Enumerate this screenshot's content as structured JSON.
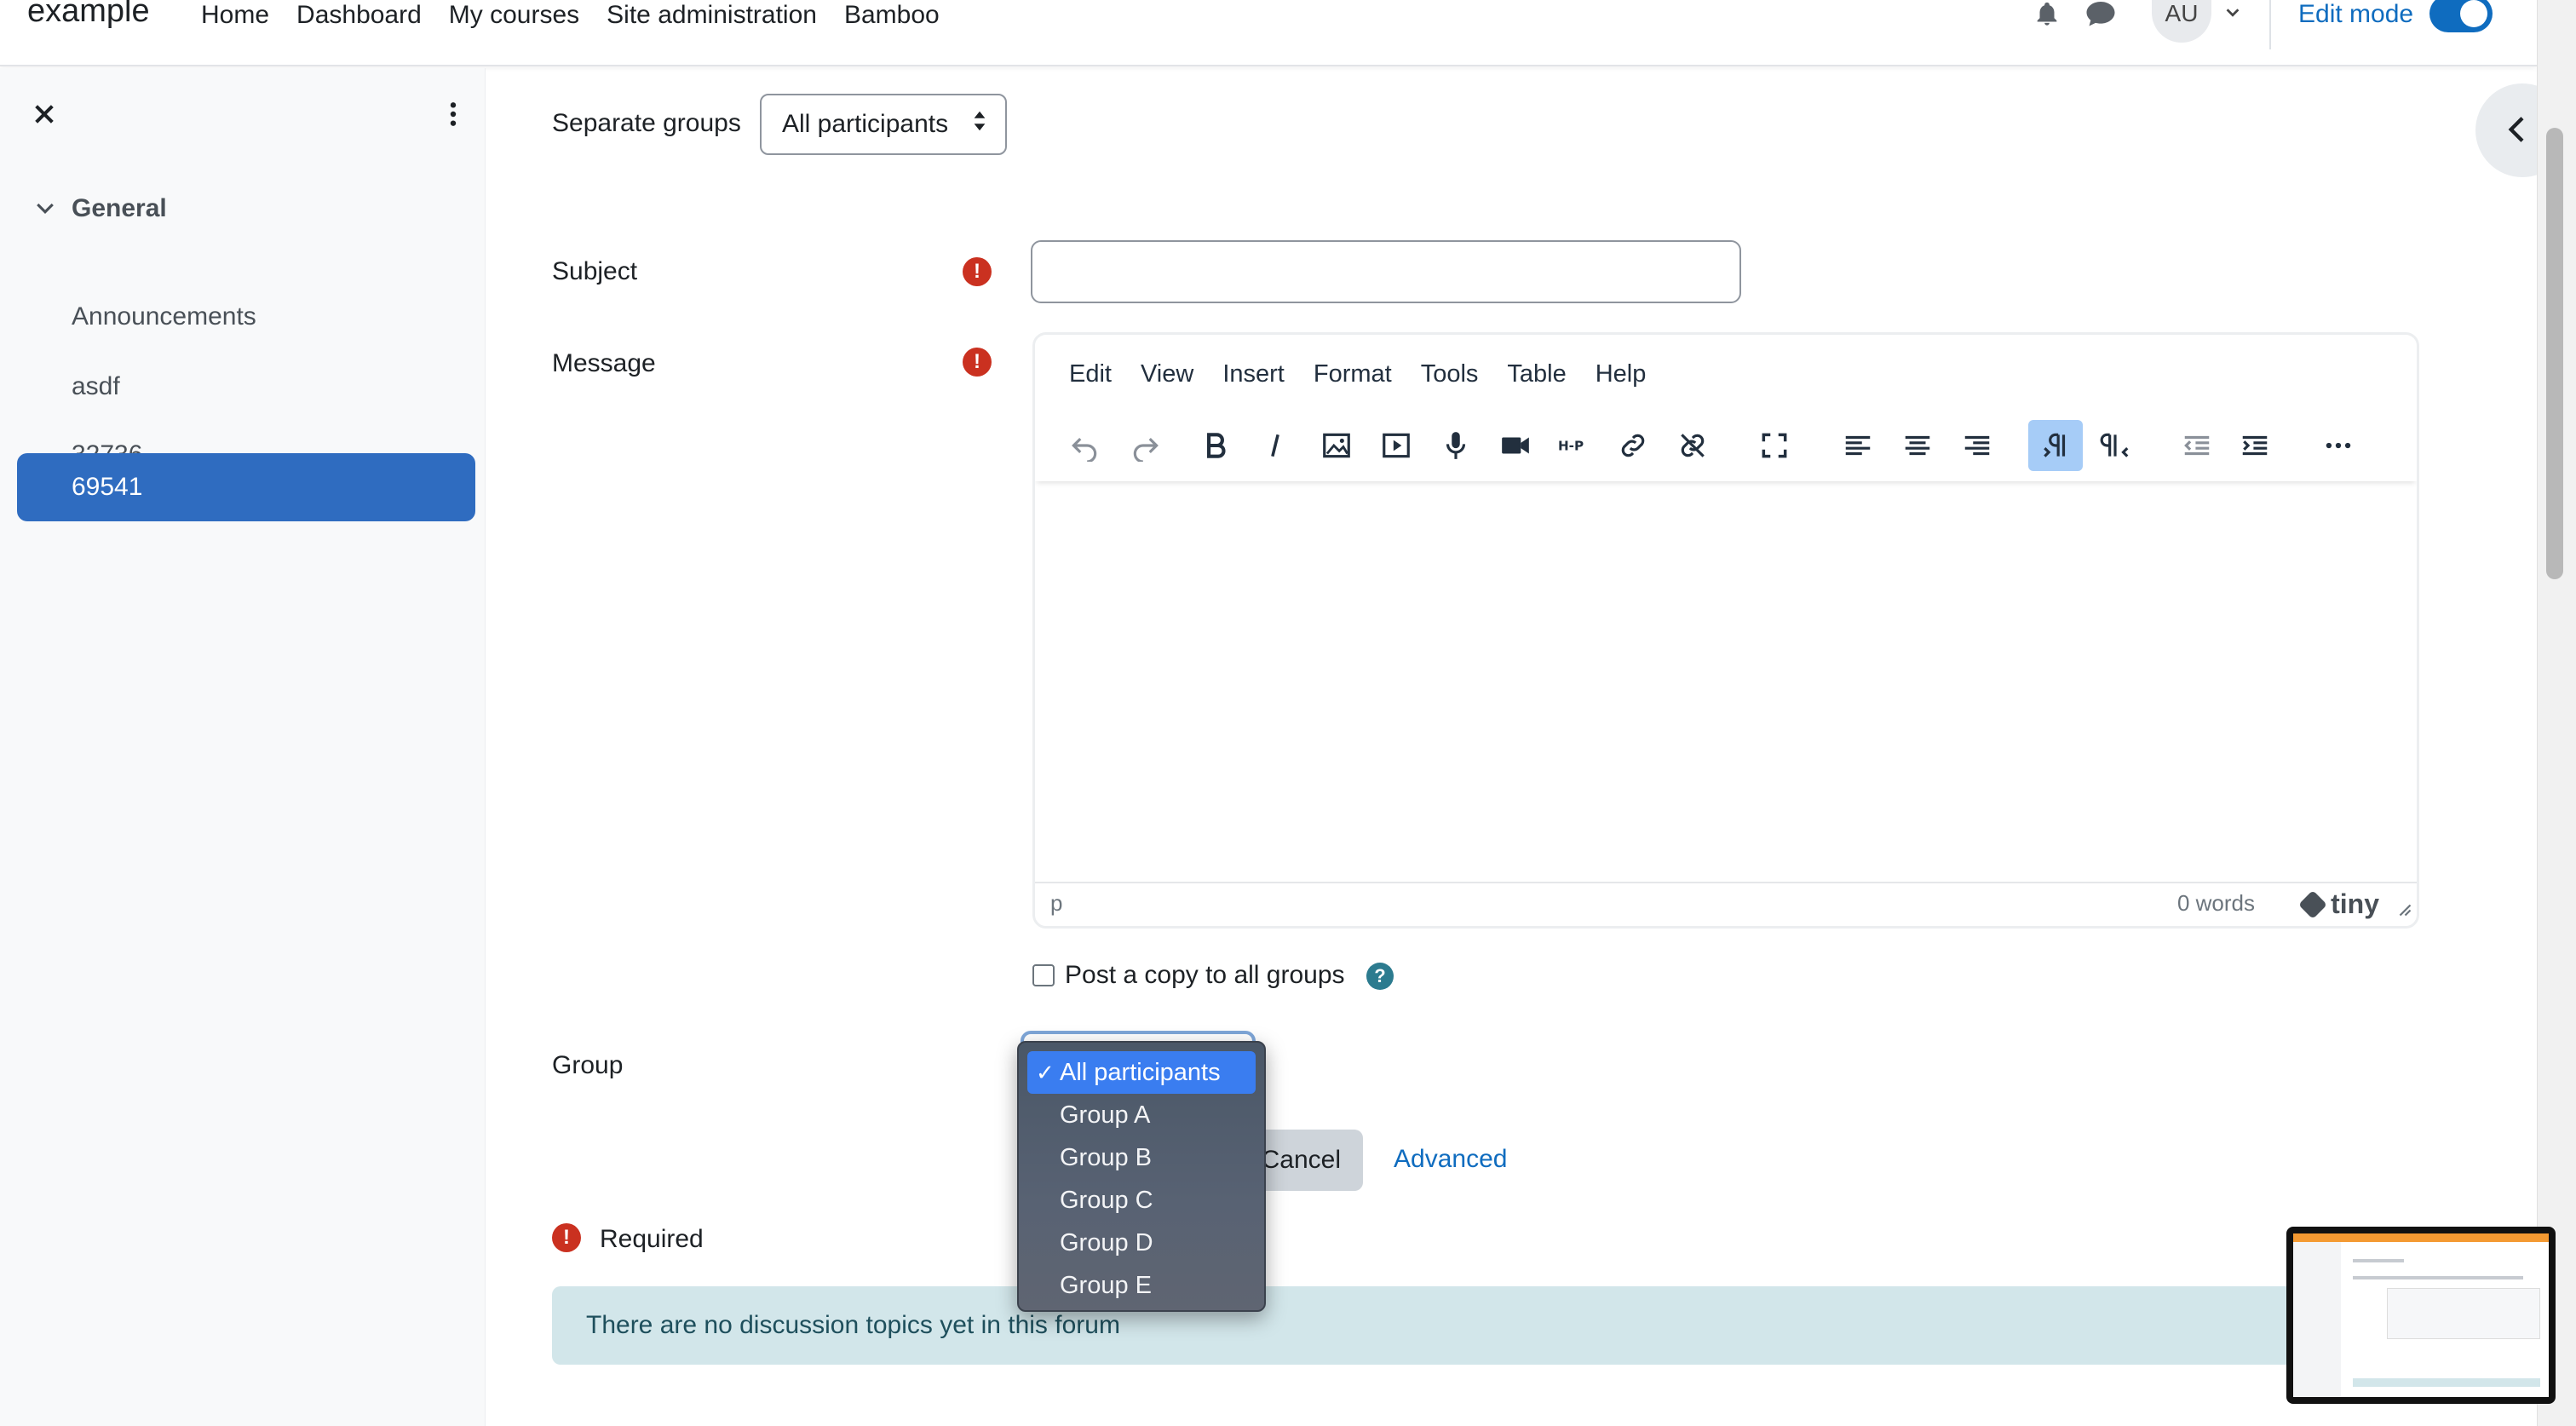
{
  "navbar": {
    "brand": "example",
    "links": [
      "Home",
      "Dashboard",
      "My courses",
      "Site administration",
      "Bamboo"
    ],
    "avatar_initials": "AU",
    "edit_mode_label": "Edit mode",
    "edit_mode_on": true
  },
  "sidebar": {
    "section_title": "General",
    "items": [
      "Announcements",
      "asdf",
      "32736",
      "69541"
    ],
    "active_item": "69541"
  },
  "form": {
    "separate_groups_label": "Separate groups",
    "separate_groups_value": "All participants",
    "subject_label": "Subject",
    "subject_value": "",
    "message_label": "Message",
    "editor": {
      "menu": [
        "Edit",
        "View",
        "Insert",
        "Format",
        "Tools",
        "Table",
        "Help"
      ],
      "status_path": "p",
      "word_count": "0 words",
      "brand": "tiny"
    },
    "post_copy_label": "Post a copy to all groups",
    "post_copy_checked": false,
    "group_label": "Group",
    "group_options": [
      "All participants",
      "Group A",
      "Group B",
      "Group C",
      "Group D",
      "Group E"
    ],
    "group_selected": "All participants",
    "cancel_label": "Cancel",
    "advanced_label": "Advanced",
    "required_label": "Required"
  },
  "alert": {
    "message": "There are no discussion topics yet in this forum"
  },
  "colors": {
    "primary": "#0f6cbf",
    "active_item": "#2f6cc0",
    "required": "#ca3120",
    "info_bg": "#d2e6ea"
  }
}
